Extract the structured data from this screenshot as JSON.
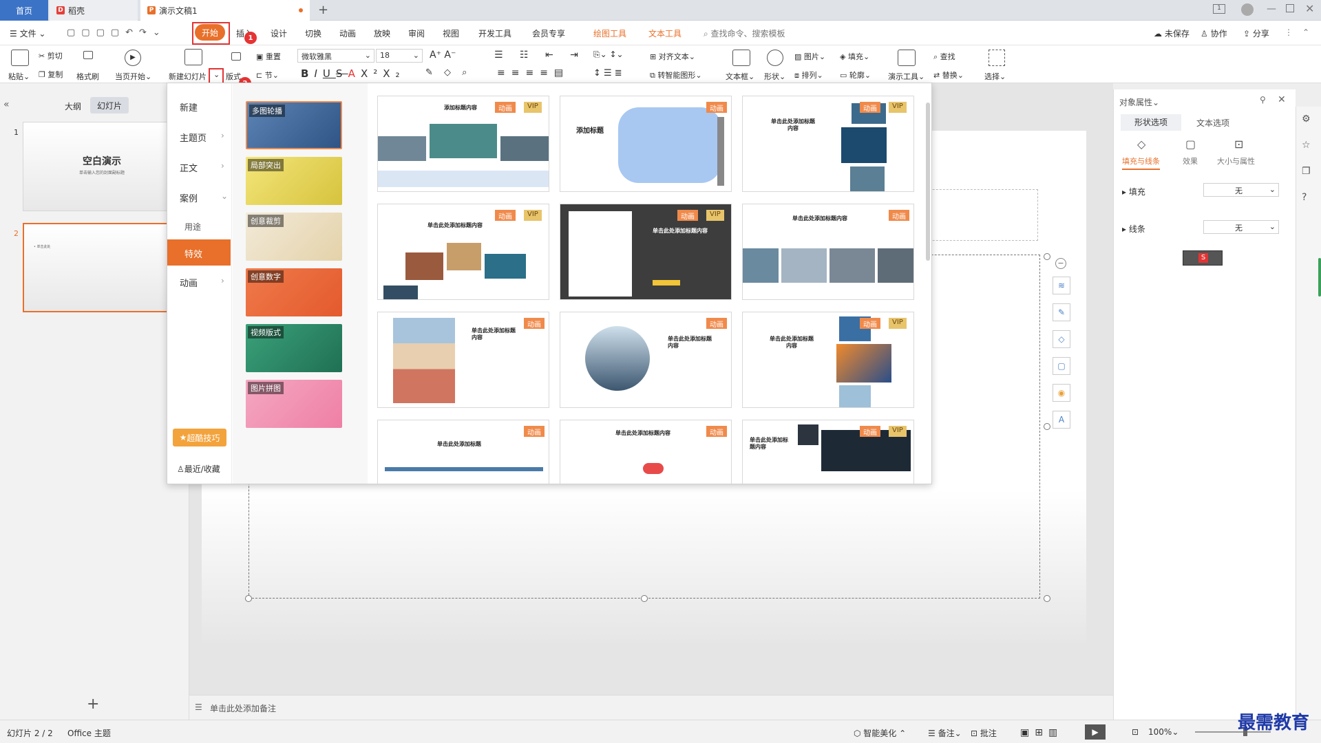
{
  "tabs": {
    "home": "首页",
    "wps": "稻壳",
    "doc": "演示文稿1"
  },
  "menu": [
    "文件",
    "开始",
    "插入",
    "设计",
    "切换",
    "动画",
    "放映",
    "审阅",
    "视图",
    "开发工具",
    "会员专享",
    "绘图工具",
    "文本工具"
  ],
  "search_placeholder": "查找命令、搜索模板",
  "menu_right": {
    "unsaved": "未保存",
    "collab": "协作",
    "share": "分享"
  },
  "ribbon": {
    "paste": "粘贴",
    "cut": "剪切",
    "copy": "复制",
    "format_painter": "格式刷",
    "from_current": "当页开始",
    "new_slide": "新建幻灯片",
    "layout": "版式",
    "reset": "重置",
    "section": "节",
    "font": "微软雅黑",
    "size": "18",
    "align_text": "对齐文本",
    "smart_art": "转智能图形",
    "textbox": "文本框",
    "shape": "形状",
    "picture": "图片",
    "fill": "填充",
    "arrange": "排列",
    "outline": "轮廓",
    "present_tools": "演示工具",
    "find": "查找",
    "replace": "替换",
    "select": "选择"
  },
  "badges": [
    "1",
    "2",
    "3"
  ],
  "left_panel": {
    "outline": "大纲",
    "slides": "幻灯片",
    "slide1_title": "空白演示",
    "slide1_sub": "单击输入您的封面副标题",
    "slide2_text": "• 单击此处",
    "num1": "1",
    "num2": "2"
  },
  "dropdown": {
    "categories": {
      "new": "新建",
      "theme": "主题页",
      "body": "正文",
      "cases": "案例",
      "usage": "用途",
      "effects": "特效",
      "animation": "动画",
      "tips": "超酷技巧",
      "recent": "最近/收藏"
    },
    "subs": [
      "多图轮播",
      "局部突出",
      "创意裁剪",
      "创意数字",
      "视频版式",
      "图片拼图"
    ],
    "tag_anim": "动画",
    "tag_vip": "VIP",
    "cards": [
      "添加标题内容",
      "添加标题",
      "单击此处添加标题内容",
      "单击此处添加标题内容",
      "单击此处添加标题内容",
      "单击此处添加标题内容",
      "单击此处添加标题内容",
      "单击此处添加标题内容",
      "单击此处添加标题内容",
      "单击此处添加标题",
      "单击此处添加标题内容",
      "单击此处添加标题内容"
    ]
  },
  "right_panel": {
    "title": "对象属性",
    "tab1": "形状选项",
    "tab2": "文本选项",
    "sub1": "填充与线条",
    "sub2": "效果",
    "sub3": "大小与属性",
    "fill": "填充",
    "line": "线条",
    "none": "无"
  },
  "notes": "单击此处添加备注",
  "status": {
    "slide": "幻灯片 2 / 2",
    "theme": "Office 主题",
    "beautify": "智能美化",
    "notes": "备注",
    "comment": "批注",
    "zoom": "100%"
  },
  "watermark": "最需教育",
  "colors": {
    "accent": "#e8702a",
    "red": "#e23434",
    "blue": "#3b73c6"
  }
}
